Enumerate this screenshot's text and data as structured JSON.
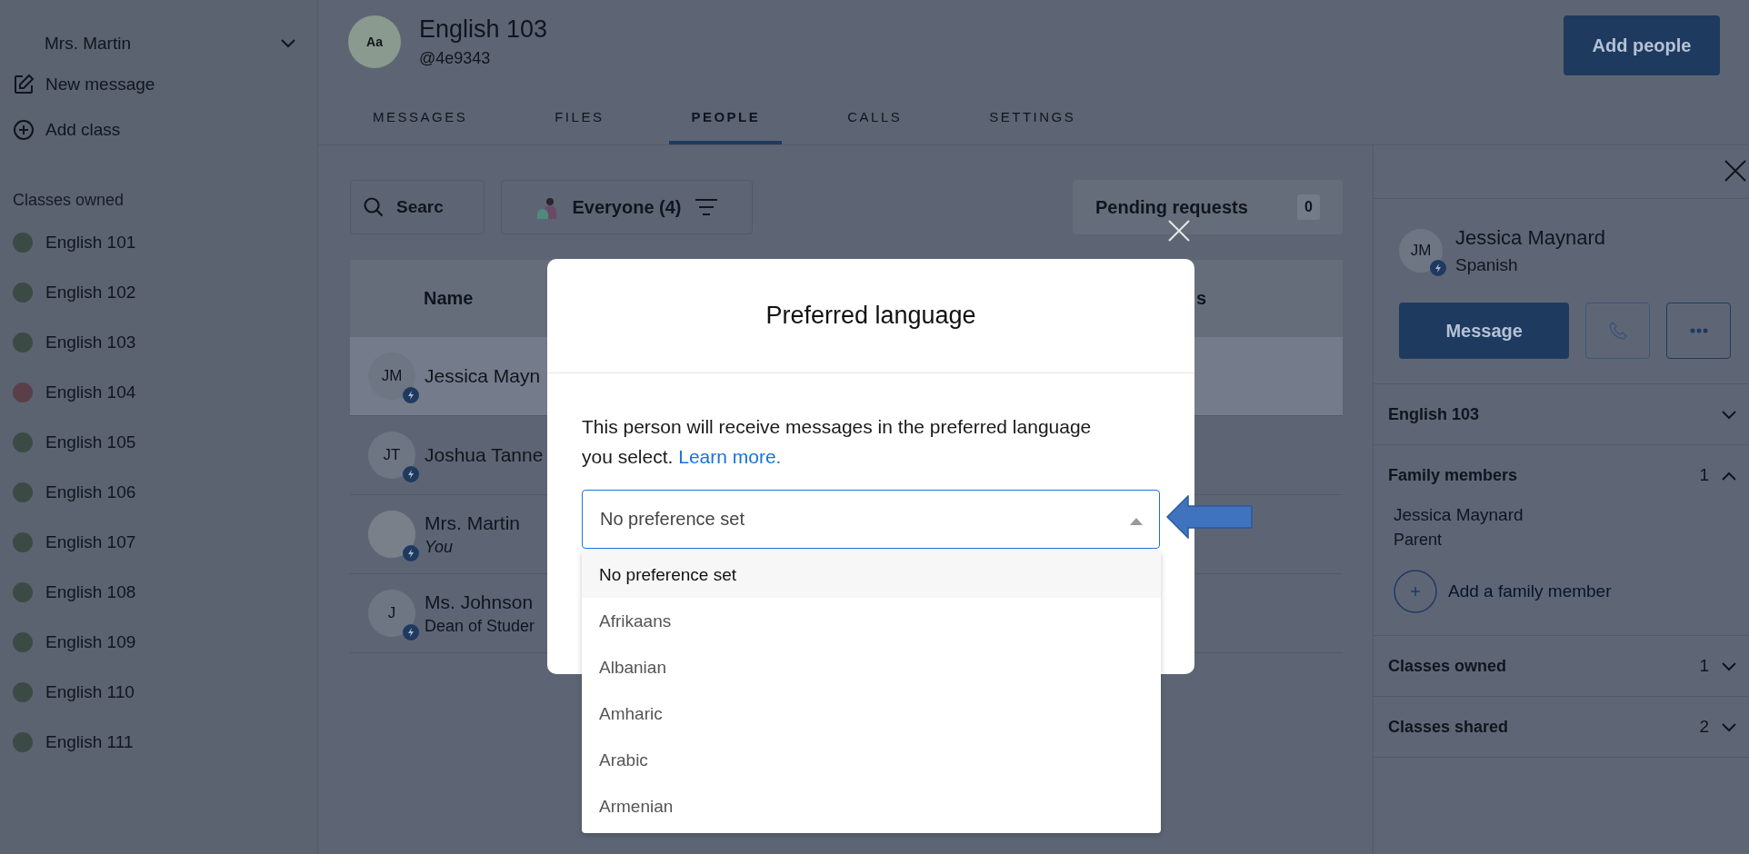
{
  "sidebar": {
    "account": {
      "name": "Mrs. Martin"
    },
    "actions": [
      {
        "kind": "compose",
        "label": "New message"
      },
      {
        "kind": "add",
        "label": "Add class"
      }
    ],
    "section_title": "Classes owned",
    "classes": [
      {
        "name": "English 101",
        "color": "#3c4a45"
      },
      {
        "name": "English 102",
        "color": "#3c4a45"
      },
      {
        "name": "English 103",
        "color": "#3c4a45"
      },
      {
        "name": "English 104",
        "color": "#5a3f48"
      },
      {
        "name": "English 105",
        "color": "#3c4a45"
      },
      {
        "name": "English 106",
        "color": "#3c4a45"
      },
      {
        "name": "English 107",
        "color": "#3c4a45"
      },
      {
        "name": "English 108",
        "color": "#3c4a45"
      },
      {
        "name": "English 109",
        "color": "#3c4a45"
      },
      {
        "name": "English 110",
        "color": "#3c4a45"
      },
      {
        "name": "English 111",
        "color": "#3c4a45"
      }
    ]
  },
  "class_header": {
    "avatar_text": "Aa",
    "title": "English 103",
    "code": "@4e9343",
    "button": "Add people"
  },
  "tabs": [
    {
      "label": "MESSAGES",
      "selected": false
    },
    {
      "label": "FILES",
      "selected": false
    },
    {
      "label": "PEOPLE",
      "selected": true
    },
    {
      "label": "CALLS",
      "selected": false
    },
    {
      "label": "SETTINGS",
      "selected": false
    }
  ],
  "toolbar": {
    "search": {
      "placeholder": "Searc"
    },
    "filter": {
      "label": "Everyone (4)"
    },
    "pending": {
      "label": "Pending requests",
      "count": "0"
    }
  },
  "table": {
    "columns": [
      {
        "label": "Name"
      },
      {
        "label": "s"
      }
    ],
    "rows": [
      {
        "kind": "initials",
        "initials": "JM",
        "name": "Jessica Mayn",
        "selected": true
      },
      {
        "kind": "initials",
        "initials": "JT",
        "name": "Joshua Tanne",
        "selected": false
      },
      {
        "kind": "self",
        "name": "Mrs. Martin",
        "subtitle": "You",
        "selected": false
      },
      {
        "kind": "initials",
        "initials": "J",
        "name": "Ms. Johnson",
        "subtitle": "Dean of Studer",
        "selected": false
      }
    ]
  },
  "profile": {
    "initials": "JM",
    "name": "Jessica Maynard",
    "language": "Spanish",
    "message_button": "Message",
    "sections": [
      {
        "title": "English 103",
        "expanded": false
      },
      {
        "title": "Family members",
        "count": "1",
        "expanded": true,
        "members": [
          {
            "name": "Jessica Maynard",
            "role": "Parent"
          }
        ],
        "add_label": "Add a family member"
      },
      {
        "title": "Classes owned",
        "count": "1",
        "expanded": false
      },
      {
        "title": "Classes shared",
        "count": "2",
        "expanded": false
      }
    ]
  },
  "dialog": {
    "title": "Preferred language",
    "text": "This person will receive messages in the preferred language you select.",
    "link": "Learn more.",
    "select": {
      "value": "No preference set",
      "expanded": true
    },
    "options": [
      {
        "label": "No preference set",
        "selected": true
      },
      {
        "label": "Afrikaans",
        "selected": false
      },
      {
        "label": "Albanian",
        "selected": false
      },
      {
        "label": "Amharic",
        "selected": false
      },
      {
        "label": "Arabic",
        "selected": false
      },
      {
        "label": "Armenian",
        "selected": false
      }
    ]
  }
}
